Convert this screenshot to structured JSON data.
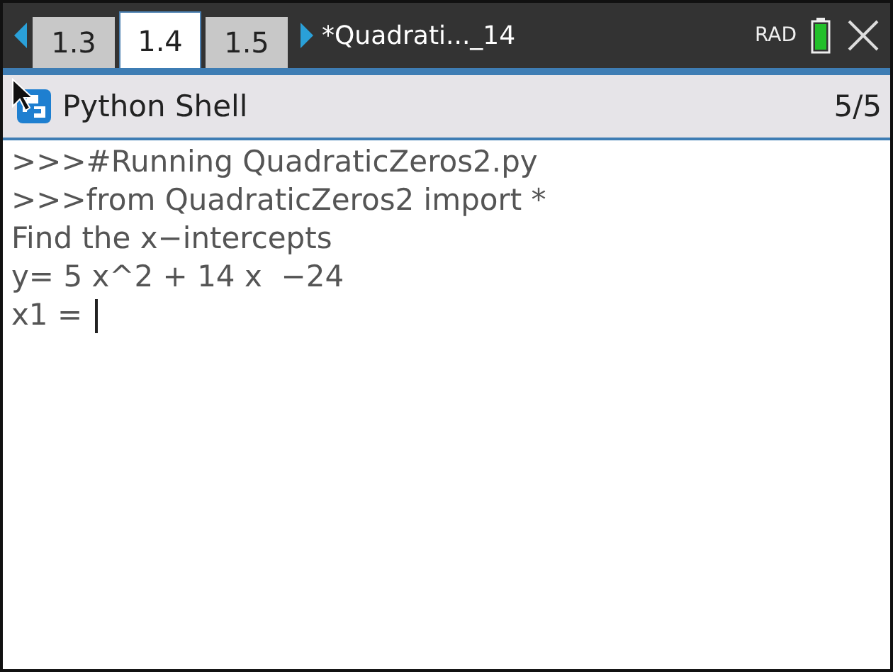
{
  "tabs": [
    {
      "label": "1.3",
      "selected": false
    },
    {
      "label": "1.4",
      "selected": true
    },
    {
      "label": "1.5",
      "selected": false
    }
  ],
  "document_title": "*Quadrati..._14",
  "angle_mode": "RAD",
  "app_header": {
    "title": "Python Shell",
    "page": "5/5"
  },
  "shell_lines": [
    ">>>#Running QuadraticZeros2.py",
    ">>>from QuadraticZeros2 import *",
    "Find the x−intercepts",
    "y= 5 x^2 + 14 x  −24"
  ],
  "input_line": {
    "prompt": "x1 = "
  }
}
